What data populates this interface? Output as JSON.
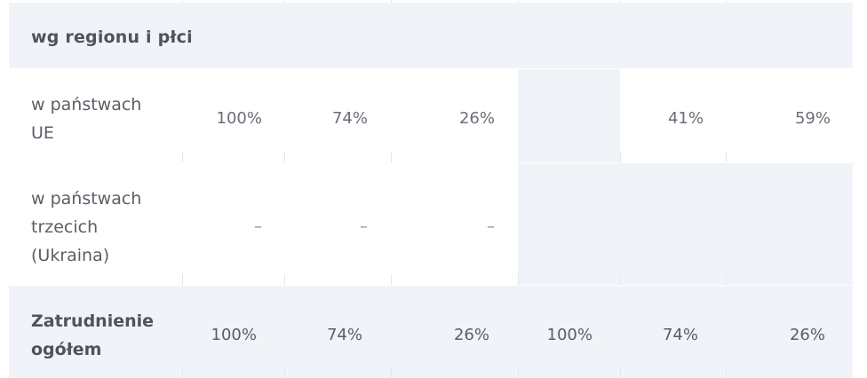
{
  "section": {
    "title": "wg regionu i płci"
  },
  "rows": [
    {
      "label_lines": [
        "w państwach",
        "UE"
      ],
      "values": [
        "100%",
        "74%",
        "26%",
        "",
        "41%",
        "59%"
      ]
    },
    {
      "label_lines": [
        "w państwach",
        "trzecich",
        "(Ukraina)"
      ],
      "values": [
        "–",
        "–",
        "–",
        "",
        "",
        ""
      ]
    }
  ],
  "total": {
    "label_lines": [
      "Zatrudnienie",
      "ogółem"
    ],
    "values": [
      "100%",
      "74%",
      "26%",
      "100%",
      "74%",
      "26%"
    ]
  }
}
